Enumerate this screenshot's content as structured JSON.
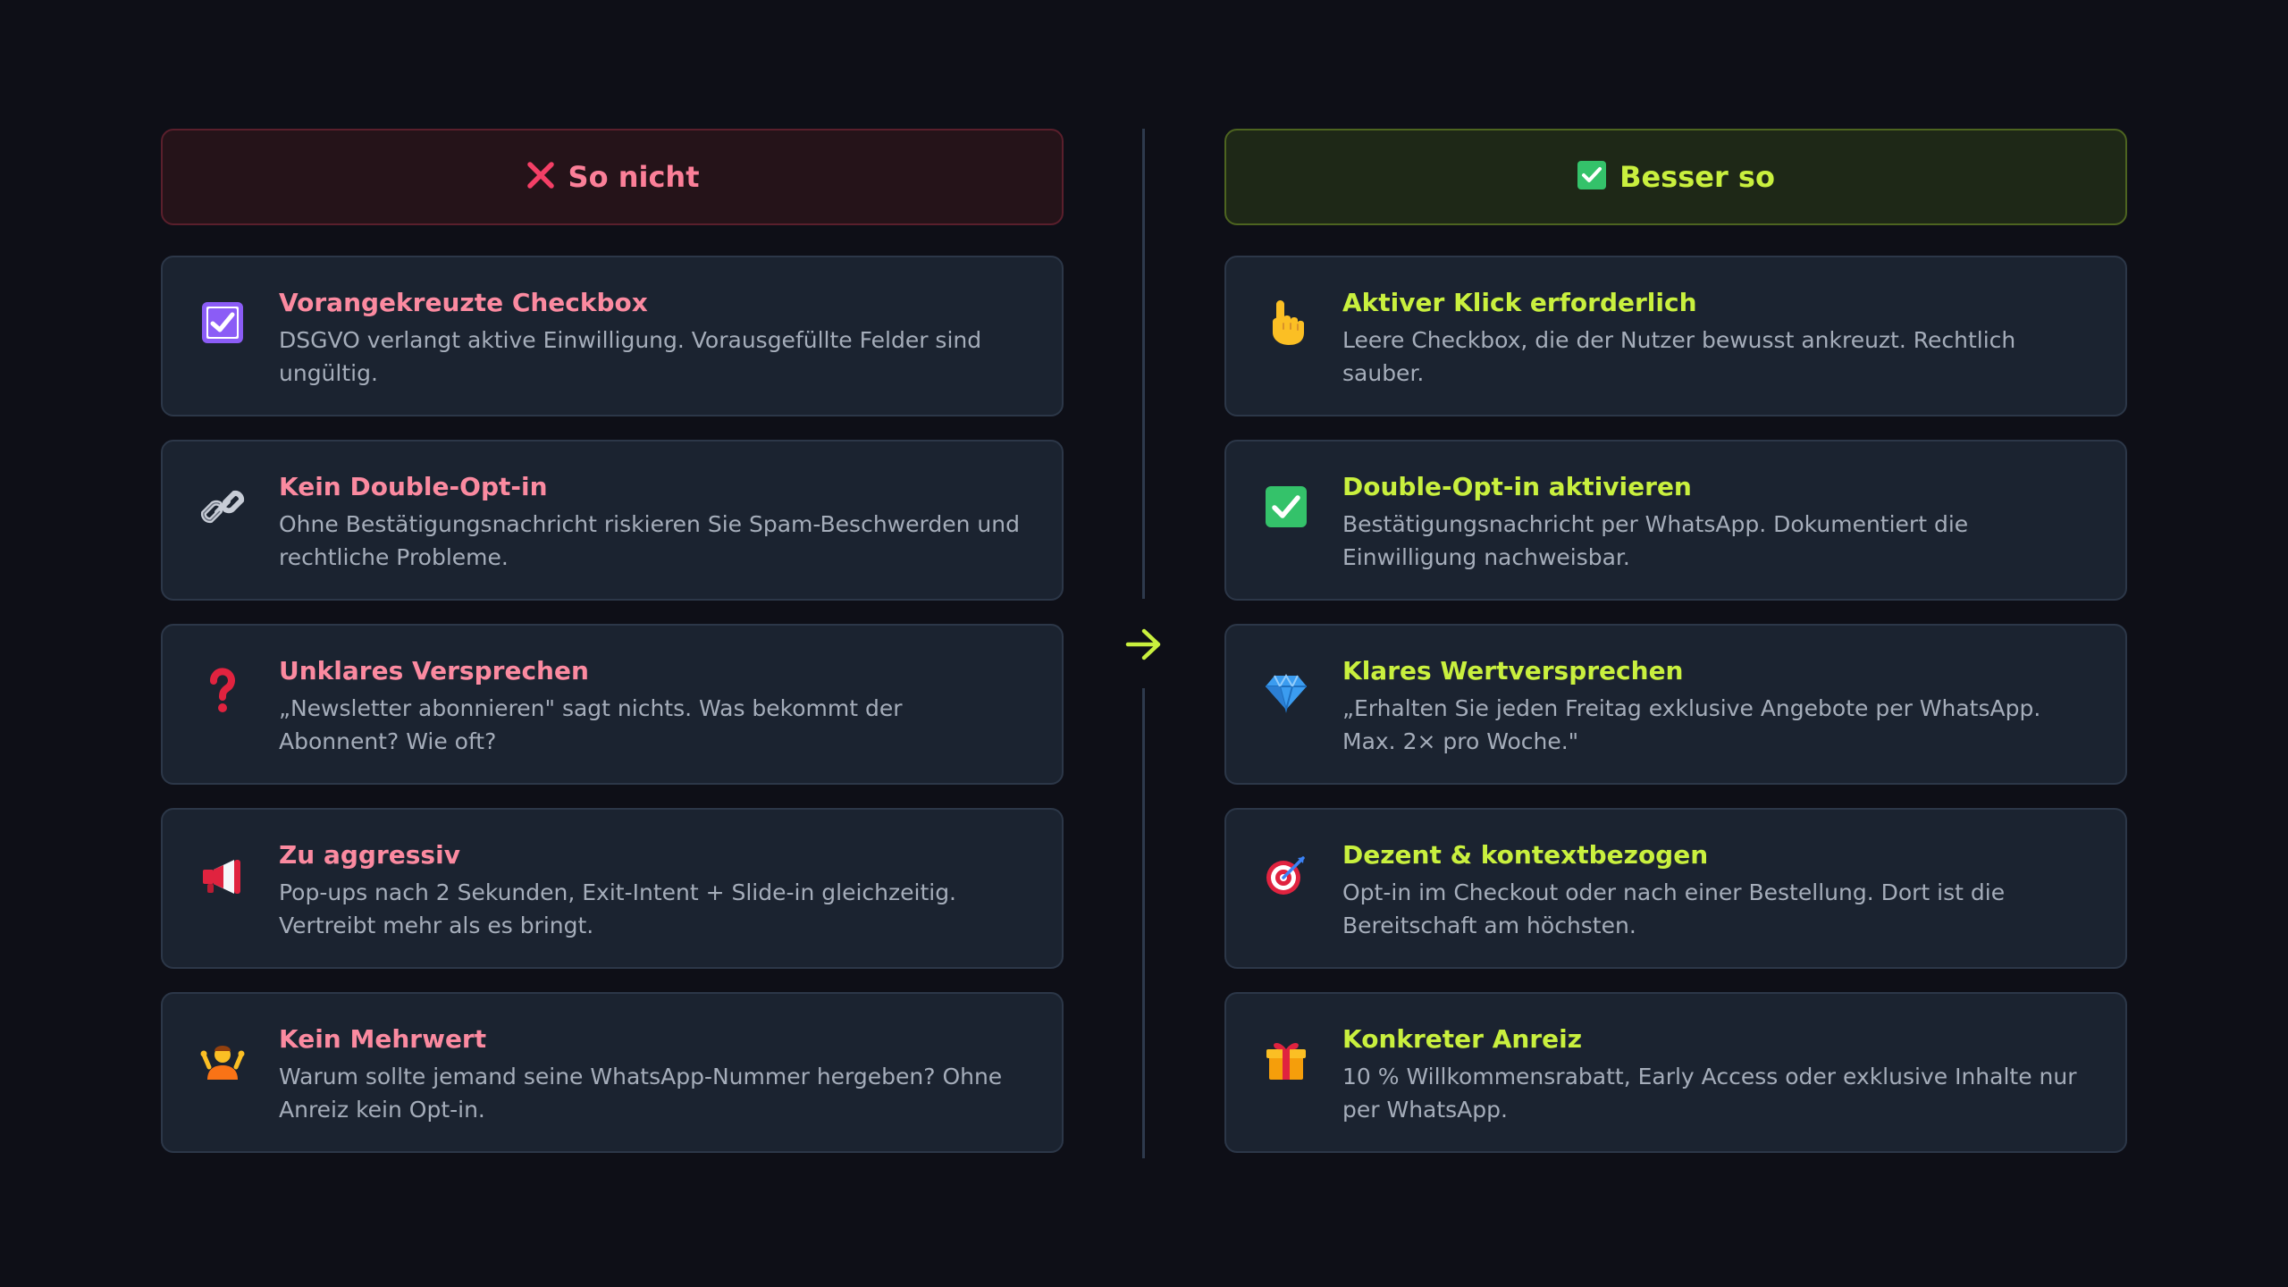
{
  "left": {
    "header": {
      "icon": "cross-icon",
      "title": "So nicht",
      "color": "#fb7f98"
    },
    "items": [
      {
        "icon": "checked-checkbox-icon",
        "title": "Vorangekreuzte Checkbox",
        "desc": "DSGVO verlangt aktive Einwilligung. Vorausgefüllte Felder sind ungültig."
      },
      {
        "icon": "link-icon",
        "title": "Kein Double-Opt-in",
        "desc": "Ohne Bestätigungsnachricht riskieren Sie Spam-Beschwerden und rechtliche Probleme."
      },
      {
        "icon": "question-mark-icon",
        "title": "Unklares Versprechen",
        "desc": "„Newsletter abonnieren\" sagt nichts. Was bekommt der Abonnent? Wie oft?"
      },
      {
        "icon": "megaphone-icon",
        "title": "Zu aggressiv",
        "desc": "Pop-ups nach 2 Sekunden, Exit-Intent + Slide-in gleichzeitig. Vertreibt mehr als es bringt."
      },
      {
        "icon": "shrug-icon",
        "title": "Kein Mehrwert",
        "desc": "Warum sollte jemand seine WhatsApp-Nummer hergeben? Ohne Anreiz kein Opt-in."
      }
    ]
  },
  "right": {
    "header": {
      "icon": "check-box-icon",
      "title": "Besser so",
      "color": "#c9f03e"
    },
    "items": [
      {
        "icon": "pointing-hand-icon",
        "title": "Aktiver Klick erforderlich",
        "desc": "Leere Checkbox, die der Nutzer bewusst ankreuzt. Rechtlich sauber."
      },
      {
        "icon": "check-box-icon",
        "title": "Double-Opt-in aktivieren",
        "desc": "Bestätigungsnachricht per WhatsApp. Dokumentiert die Einwilligung nachweisbar."
      },
      {
        "icon": "diamond-icon",
        "title": "Klares Wertversprechen",
        "desc": "„Erhalten Sie jeden Freitag exklusive Angebote per WhatsApp. Max. 2× pro Woche.\""
      },
      {
        "icon": "target-icon",
        "title": "Dezent & kontextbezogen",
        "desc": "Opt-in im Checkout oder nach einer Bestellung. Dort ist die Bereitschaft am höchsten."
      },
      {
        "icon": "gift-icon",
        "title": "Konkreter Anreiz",
        "desc": "10 % Willkommensrabatt, Early Access oder exklusive Inhalte nur per WhatsApp."
      }
    ]
  },
  "divider": {
    "icon": "arrow-right-icon",
    "color": "#c9f03e"
  }
}
